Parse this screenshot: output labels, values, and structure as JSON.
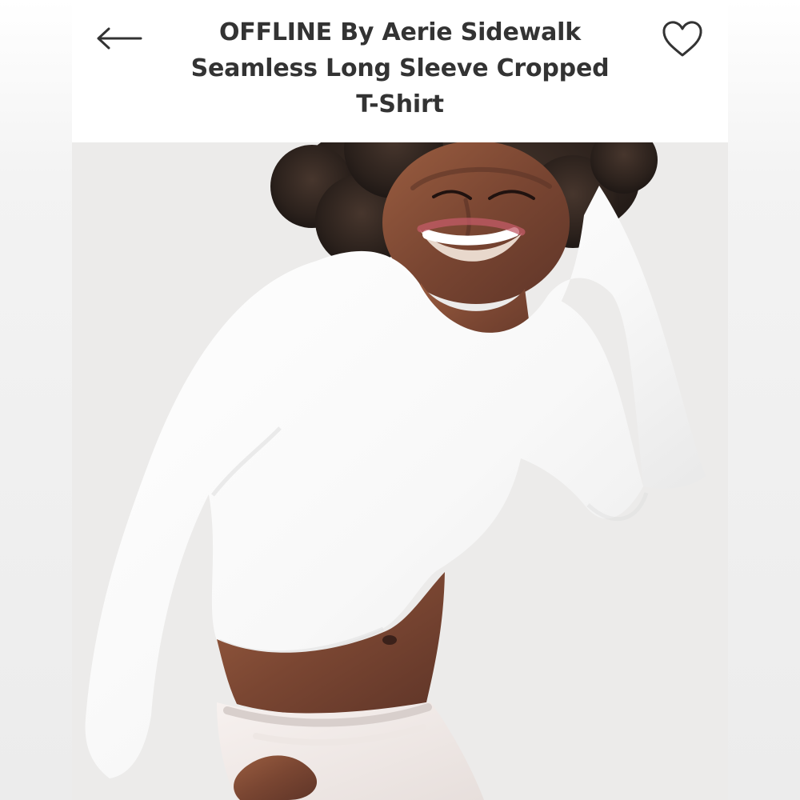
{
  "product": {
    "title": "OFFLINE By Aerie Sidewalk Seamless Long Sleeve Cropped T-Shirt"
  },
  "icons": {
    "back": "back-arrow-icon",
    "favorite": "heart-outline-icon"
  },
  "colors": {
    "title_text": "#333333",
    "header_background": "#ffffff",
    "image_background": "#ecebea",
    "shirt": "#ffffff",
    "skin": "#7b4b35",
    "hair": "#2f241e",
    "pants": "#f4efed"
  }
}
